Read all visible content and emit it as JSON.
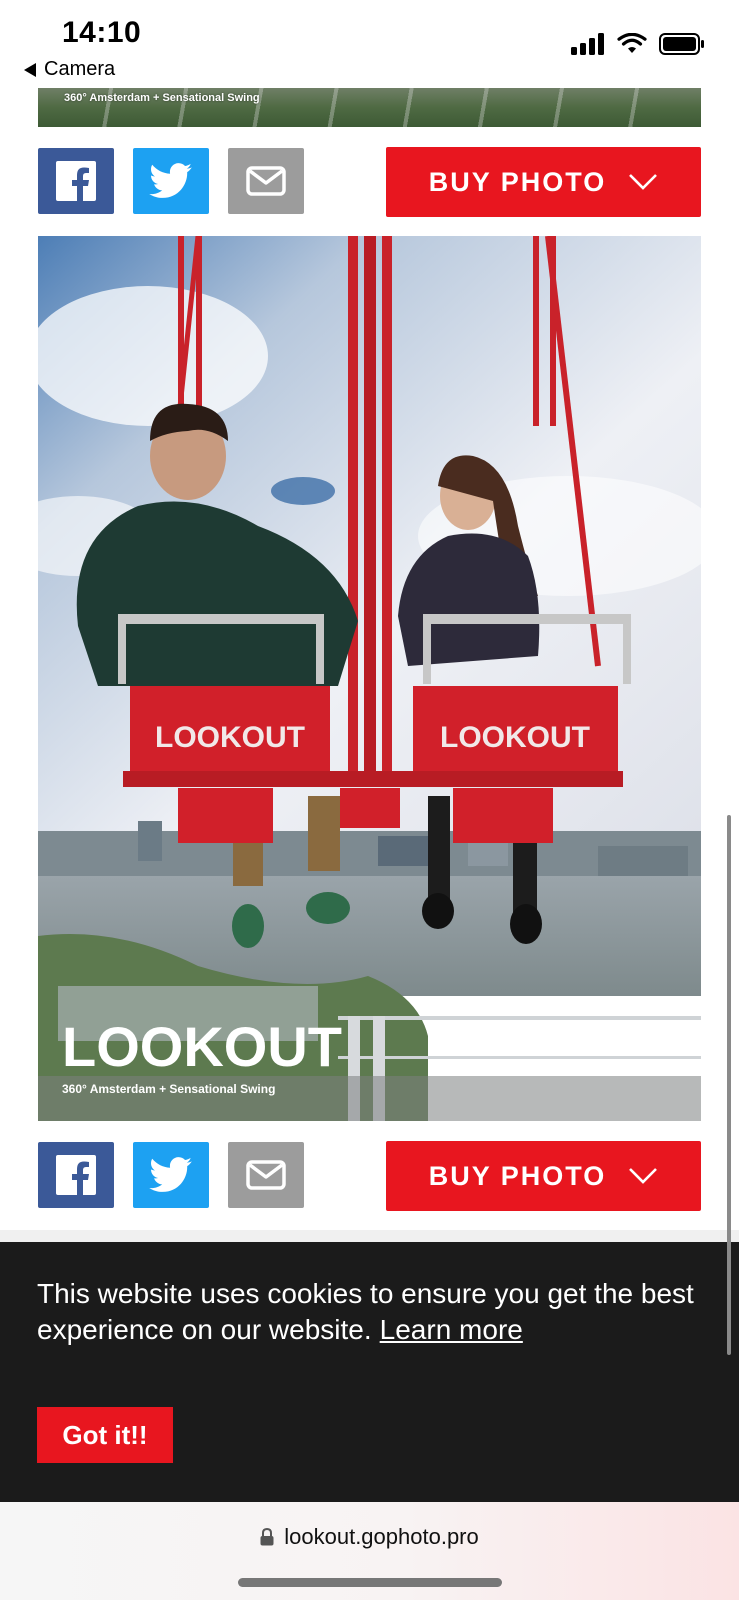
{
  "status_bar": {
    "time": "14:10",
    "back_label": "Camera"
  },
  "photo": {
    "caption_small": "360° Amsterdam + Sensational Swing",
    "brand_logo": "LOOKOUT",
    "seat_logo_left": "LOOKOUT",
    "seat_logo_right": "LOOKOUT",
    "caption": "360° Amsterdam + Sensational Swing"
  },
  "share_top": {
    "facebook_icon": "facebook-icon",
    "twitter_icon": "twitter-icon",
    "email_icon": "mail-icon",
    "buy_label": "BUY PHOTO"
  },
  "share_bottom": {
    "facebook_icon": "facebook-icon",
    "twitter_icon": "twitter-icon",
    "email_icon": "mail-icon",
    "buy_label": "BUY PHOTO"
  },
  "cookie": {
    "message": "This website uses cookies to ensure you get the best experience on our website.",
    "learn_more": "Learn more",
    "accept_label": "Got it!!"
  },
  "browser": {
    "url": "lookout.gophoto.pro"
  },
  "colors": {
    "brand_red": "#e8161f",
    "facebook": "#3b5998",
    "twitter": "#1da1f2",
    "email": "#9c9c9c",
    "cookie_bg": "#1b1b1b"
  }
}
